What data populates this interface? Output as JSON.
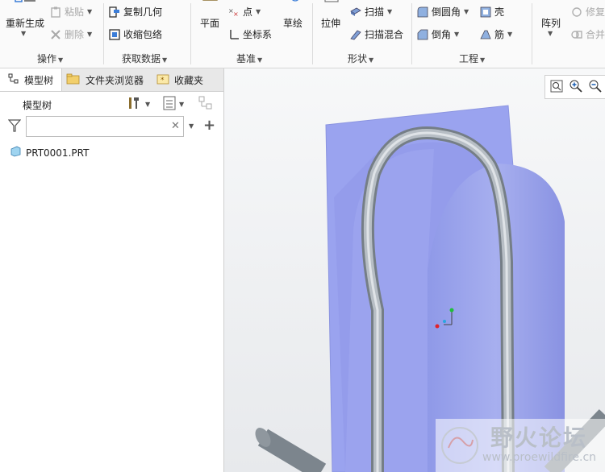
{
  "ribbon": {
    "operations": {
      "regenerate": "重新生成",
      "paste": "粘贴",
      "delete": "删除",
      "group_label": "操作"
    },
    "get_data": {
      "copy_geometry": "复制几何",
      "shrinkwrap": "收缩包络",
      "group_label": "获取数据"
    },
    "datum": {
      "plane": "平面",
      "point": "点",
      "coord_sys": "坐标系",
      "sketch": "草绘",
      "group_label": "基准"
    },
    "shapes": {
      "extrude": "拉伸",
      "sweep": "扫描",
      "swept_blend": "扫描混合",
      "group_label": "形状"
    },
    "engineering": {
      "round": "倒圆角",
      "chamfer": "倒角",
      "shell": "壳",
      "rib": "筋",
      "group_label": "工程"
    },
    "editing": {
      "pattern": "阵列",
      "modify": "修复",
      "merge": "合并"
    }
  },
  "left_panel": {
    "tabs": [
      {
        "label": "模型树"
      },
      {
        "label": "文件夹浏览器"
      },
      {
        "label": "收藏夹"
      }
    ],
    "tree_header": "模型树",
    "search_value": "",
    "tree_items": [
      {
        "label": "PRT0001.PRT"
      }
    ]
  },
  "watermark": {
    "text_cn": "野火论坛",
    "url": "www.proewildfire.cn"
  },
  "colors": {
    "model_fill": "#9aa3ef",
    "tube": "#a9b1b8",
    "ribbon_bg": "#fafafa"
  }
}
